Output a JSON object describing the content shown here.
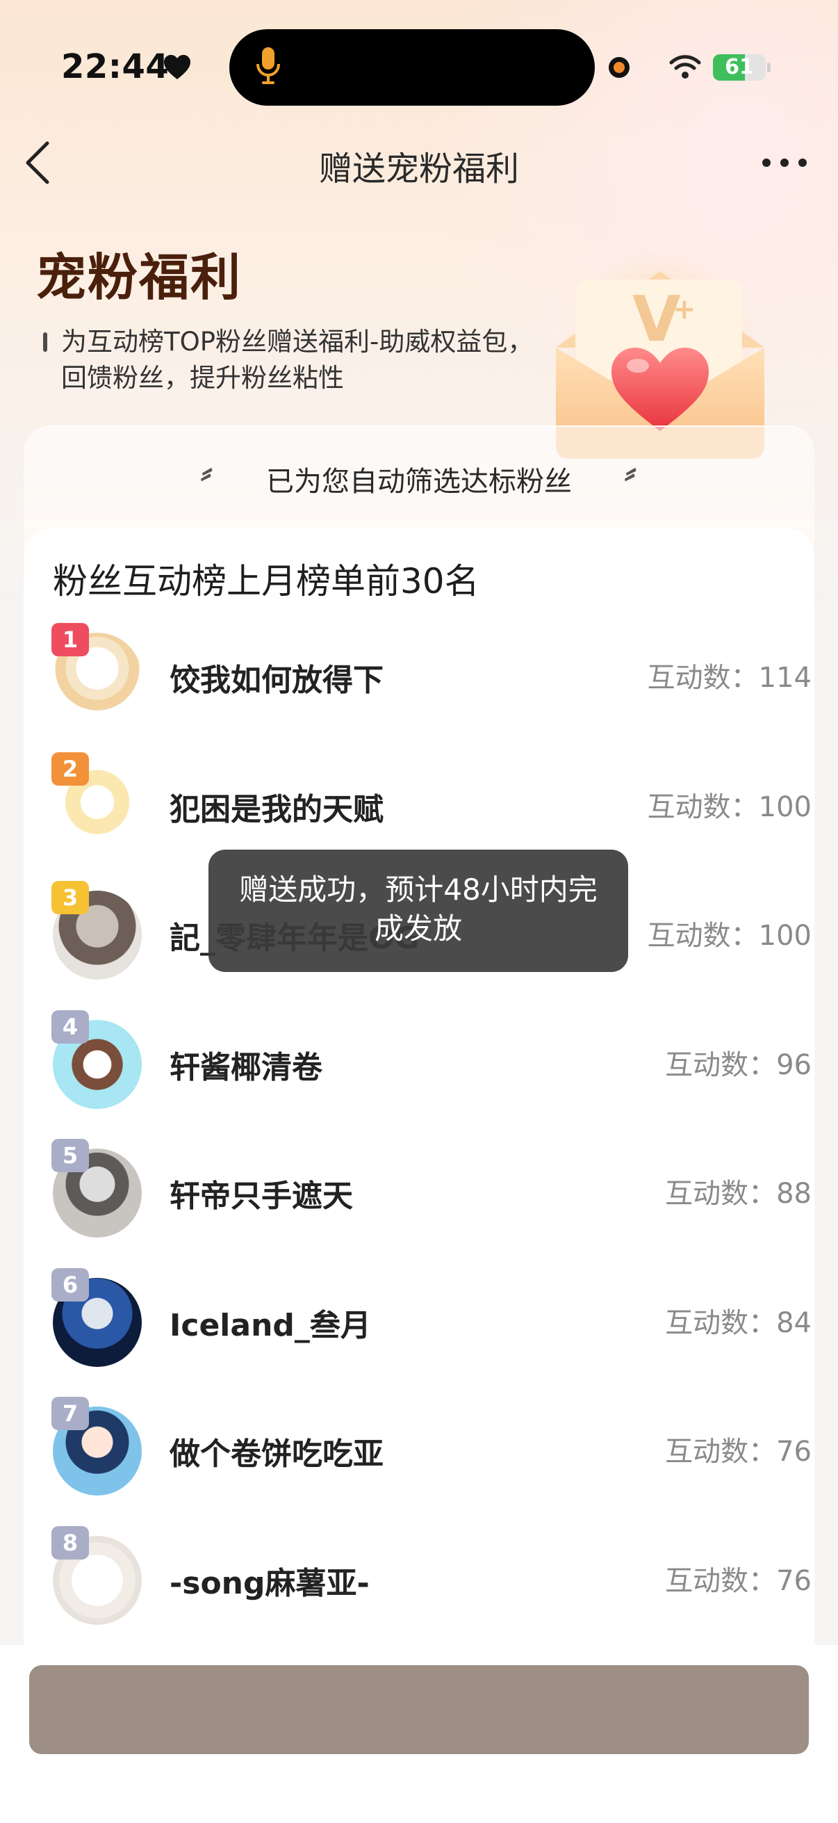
{
  "status_bar": {
    "time": "22:44",
    "battery_percent": 61,
    "battery_label": "61"
  },
  "nav": {
    "title": "赠送宠粉福利"
  },
  "hero": {
    "title": "宠粉福利",
    "description": "为互动榜TOP粉丝赠送福利-助威权益包，回馈粉丝，提升粉丝粘性"
  },
  "filter_banner": {
    "text": "已为您自动筛选达标粉丝",
    "quote_open": "〞",
    "quote_close": "〞"
  },
  "list": {
    "title": "粉丝互动榜上月榜单前30名",
    "count_prefix": "互动数：",
    "fans": [
      {
        "rank": "1",
        "name": "饺我如何放得下",
        "count": "互动数：114",
        "badge_color": "#ee4d5f"
      },
      {
        "rank": "2",
        "name": "犯困是我的天赋",
        "count": "互动数：100",
        "badge_color": "#f2913a"
      },
      {
        "rank": "3",
        "name": "記_零肆年年是OG",
        "count": "互动数：100",
        "badge_color": "#f6c233"
      },
      {
        "rank": "4",
        "name": "轩酱椰清卷",
        "count": "互动数：96",
        "badge_color": "#a9adc7"
      },
      {
        "rank": "5",
        "name": "轩帝只手遮天",
        "count": "互动数：88",
        "badge_color": "#a9adc7"
      },
      {
        "rank": "6",
        "name": "Iceland_叁月",
        "count": "互动数：84",
        "badge_color": "#a9adc7"
      },
      {
        "rank": "7",
        "name": "做个卷饼吃吃亚",
        "count": "互动数：76",
        "badge_color": "#a9adc7"
      },
      {
        "rank": "8",
        "name": "-song麻薯亚-",
        "count": "互动数：76",
        "badge_color": "#a9adc7"
      }
    ]
  },
  "toast": {
    "text": "赠送成功，预计48小时内完成发放"
  },
  "colors": {
    "accent_dark": "#4a200c",
    "button_disabled": "#9d8f85",
    "battery_green": "#3fbf5b"
  },
  "icons": [
    "heart-icon",
    "mic-icon",
    "wifi-icon",
    "back-icon",
    "more-icon",
    "envelope-illustration"
  ]
}
